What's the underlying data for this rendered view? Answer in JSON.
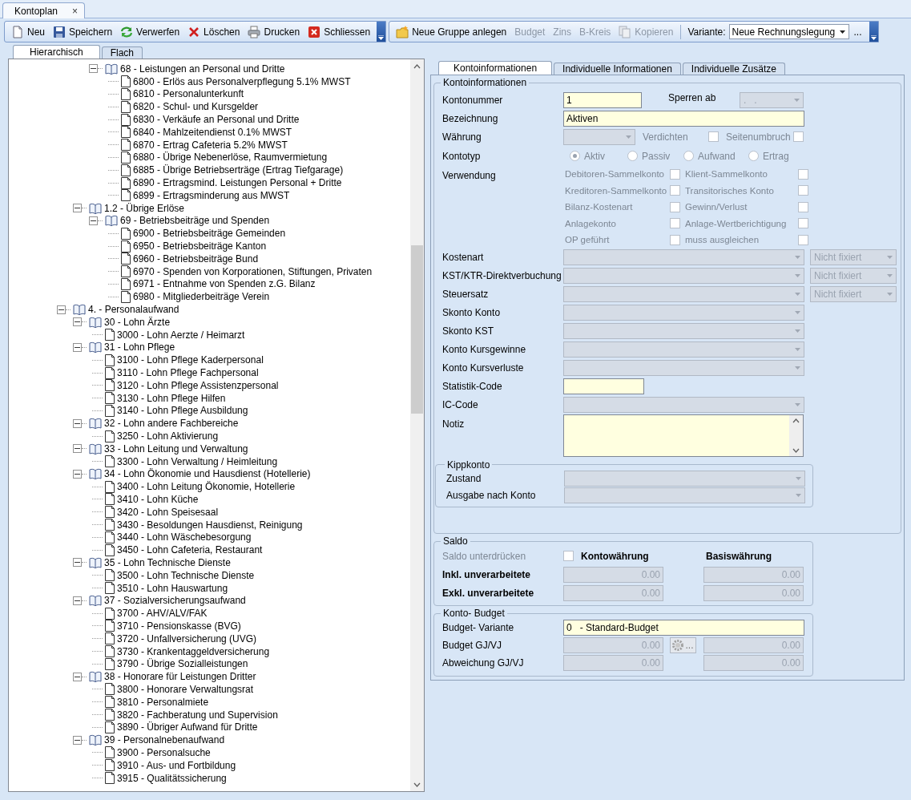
{
  "document_tabs": [
    {
      "label": "Kontoplan",
      "selected": true,
      "close": "×"
    }
  ],
  "toolbar": {
    "groups": [
      {
        "items": [
          {
            "kind": "new",
            "label": "Neu",
            "disabled": false
          },
          {
            "kind": "save",
            "label": "Speichern",
            "disabled": false
          },
          {
            "kind": "discard",
            "label": "Verwerfen",
            "disabled": false
          },
          {
            "kind": "delete",
            "label": "Löschen",
            "disabled": false
          },
          {
            "kind": "print",
            "label": "Drucken",
            "disabled": false
          },
          {
            "kind": "close",
            "label": "Schliessen",
            "disabled": false
          }
        ]
      },
      {
        "items": [
          {
            "kind": "new-group",
            "label": "Neue Gruppe anlegen",
            "disabled": false
          },
          {
            "kind": "text",
            "label": "Budget",
            "disabled": true
          },
          {
            "kind": "text",
            "label": "Zins",
            "disabled": true
          },
          {
            "kind": "text",
            "label": "B-Kreis",
            "disabled": true
          },
          {
            "kind": "copy",
            "label": "Kopieren",
            "disabled": true
          }
        ],
        "variant": {
          "label": "Variante:",
          "value": "Neue Rechnungslegung",
          "more": "..."
        }
      }
    ]
  },
  "view_tabs": [
    {
      "label": "Hierarchisch",
      "selected": true
    },
    {
      "label": "Flach",
      "selected": false
    }
  ],
  "tree": {
    "items": [
      {
        "children": [
          {
            "children": [
              {
                "children": [
                  {
                    "kind": "group",
                    "label": "68 - Leistungen an Personal und Dritte",
                    "expanded": true,
                    "children": [
                      {
                        "kind": "account",
                        "label": "6800 - Erlös aus Personalverpflegung 5.1% MWST"
                      },
                      {
                        "kind": "account",
                        "label": "6810 - Personalunterkunft"
                      },
                      {
                        "kind": "account",
                        "label": "6820 - Schul- und Kursgelder"
                      },
                      {
                        "kind": "account",
                        "label": "6830 - Verkäufe an Personal und Dritte"
                      },
                      {
                        "kind": "account",
                        "label": "6840 - Mahlzeitendienst 0.1% MWST"
                      },
                      {
                        "kind": "account",
                        "label": "6870 - Ertrag Cafeteria 5.2% MWST"
                      },
                      {
                        "kind": "account",
                        "label": "6880 - Übrige Nebenerlöse, Raumvermietung"
                      },
                      {
                        "kind": "account",
                        "label": "6885 - Übrige Betriebserträge (Ertrag Tiefgarage)"
                      },
                      {
                        "kind": "account",
                        "label": "6890 - Ertragsmind. Leistungen Personal + Dritte"
                      },
                      {
                        "kind": "account",
                        "label": "6899 - Ertragsminderung aus MWST"
                      }
                    ]
                  }
                ]
              },
              {
                "kind": "group",
                "label": "1.2 - Übrige Erlöse",
                "expanded": true,
                "children": [
                  {
                    "kind": "group",
                    "label": "69 - Betriebsbeiträge und Spenden",
                    "expanded": true,
                    "children": [
                      {
                        "kind": "account",
                        "label": "6900 - Betriebsbeiträge Gemeinden"
                      },
                      {
                        "kind": "account",
                        "label": "6950 - Betriebsbeiträge Kanton"
                      },
                      {
                        "kind": "account",
                        "label": "6960 - Betriebsbeiträge Bund"
                      },
                      {
                        "kind": "account",
                        "label": "6970 - Spenden von Korporationen, Stiftungen, Privaten"
                      },
                      {
                        "kind": "account",
                        "label": "6971 - Entnahme von Spenden z.G. Bilanz"
                      },
                      {
                        "kind": "account",
                        "label": "6980 - Mitgliederbeiträge Verein"
                      }
                    ]
                  }
                ]
              }
            ]
          },
          {
            "kind": "group",
            "label": "4. - Personalaufwand",
            "expanded": true,
            "children": [
              {
                "kind": "group",
                "label": "30 - Lohn Ärzte",
                "expanded": true,
                "children": [
                  {
                    "kind": "account",
                    "label": "3000 - Lohn Aerzte / Heimarzt"
                  }
                ]
              },
              {
                "kind": "group",
                "label": "31 - Lohn Pflege",
                "expanded": true,
                "children": [
                  {
                    "kind": "account",
                    "label": "3100 - Lohn Pflege Kaderpersonal"
                  },
                  {
                    "kind": "account",
                    "label": "3110 - Lohn Pflege Fachpersonal"
                  },
                  {
                    "kind": "account",
                    "label": "3120 - Lohn Pflege Assistenzpersonal"
                  },
                  {
                    "kind": "account",
                    "label": "3130 - Lohn Pflege Hilfen"
                  },
                  {
                    "kind": "account",
                    "label": "3140 - Lohn Pflege Ausbildung"
                  }
                ]
              },
              {
                "kind": "group",
                "label": "32 - Lohn andere Fachbereiche",
                "expanded": true,
                "children": [
                  {
                    "kind": "account",
                    "label": "3250 - Lohn Aktivierung"
                  }
                ]
              },
              {
                "kind": "group",
                "label": "33 - Lohn Leitung und Verwaltung",
                "expanded": true,
                "children": [
                  {
                    "kind": "account",
                    "label": "3300 - Lohn Verwaltung / Heimleitung"
                  }
                ]
              },
              {
                "kind": "group",
                "label": "34 - Lohn Ökonomie und Hausdienst (Hotellerie)",
                "expanded": true,
                "children": [
                  {
                    "kind": "account",
                    "label": "3400 - Lohn Leitung Ökonomie, Hotellerie"
                  },
                  {
                    "kind": "account",
                    "label": "3410 - Lohn Küche"
                  },
                  {
                    "kind": "account",
                    "label": "3420 - Lohn Speisesaal"
                  },
                  {
                    "kind": "account",
                    "label": "3430 - Besoldungen Hausdienst, Reinigung"
                  },
                  {
                    "kind": "account",
                    "label": "3440 - Lohn Wäschebesorgung"
                  },
                  {
                    "kind": "account",
                    "label": "3450 - Lohn Cafeteria, Restaurant"
                  }
                ]
              },
              {
                "kind": "group",
                "label": "35 - Lohn Technische Dienste",
                "expanded": true,
                "children": [
                  {
                    "kind": "account",
                    "label": "3500 - Lohn Technische Dienste"
                  },
                  {
                    "kind": "account",
                    "label": "3510 - Lohn Hauswartung"
                  }
                ]
              },
              {
                "kind": "group",
                "label": "37 - Sozialversicherungsaufwand",
                "expanded": true,
                "children": [
                  {
                    "kind": "account",
                    "label": "3700 - AHV/ALV/FAK"
                  },
                  {
                    "kind": "account",
                    "label": "3710 - Pensionskasse (BVG)"
                  },
                  {
                    "kind": "account",
                    "label": "3720 - Unfallversicherung (UVG)"
                  },
                  {
                    "kind": "account",
                    "label": "3730 - Krankentaggeldversicherung"
                  },
                  {
                    "kind": "account",
                    "label": "3790 - Übrige Sozialleistungen"
                  }
                ]
              },
              {
                "kind": "group",
                "label": "38 - Honorare für Leistungen Dritter",
                "expanded": true,
                "children": [
                  {
                    "kind": "account",
                    "label": "3800 - Honorare Verwaltungsrat"
                  },
                  {
                    "kind": "account",
                    "label": "3810 - Personalmiete"
                  },
                  {
                    "kind": "account",
                    "label": "3820 - Fachberatung und Supervision"
                  },
                  {
                    "kind": "account",
                    "label": "3890 - Übriger Aufwand für Dritte"
                  }
                ]
              },
              {
                "kind": "group",
                "label": "39 - Personalnebenaufwand",
                "expanded": true,
                "children": [
                  {
                    "kind": "account",
                    "label": "3900 - Personalsuche"
                  },
                  {
                    "kind": "account",
                    "label": "3910 - Aus- und Fortbildung"
                  },
                  {
                    "kind": "account",
                    "label": "3915 - Qualitätssicherung"
                  }
                ]
              }
            ]
          }
        ]
      }
    ]
  },
  "detail_tabs": [
    {
      "label": "Kontoinformationen",
      "selected": true
    },
    {
      "label": "Individuelle Informationen",
      "selected": false
    },
    {
      "label": "Individuelle Zusätze",
      "selected": false
    }
  ],
  "account_info": {
    "legend": "Kontoinformationen",
    "number": {
      "label": "Kontonummer",
      "value": "1"
    },
    "lock": {
      "label": "Sperren ab",
      "value": ".   .",
      "disabled": true
    },
    "name": {
      "label": "Bezeichnung",
      "value": "Aktiven"
    },
    "currency": {
      "label": "Währung",
      "disabled": true
    },
    "compress": {
      "label": "Verdichten",
      "checked": false,
      "disabled": true
    },
    "page_break": {
      "label": "Seitenumbruch",
      "checked": false,
      "disabled": true
    },
    "type": {
      "label": "Kontotyp",
      "disabled": true,
      "options": [
        {
          "label": "Aktiv",
          "selected": true
        },
        {
          "label": "Passiv",
          "selected": false
        },
        {
          "label": "Aufwand",
          "selected": false
        },
        {
          "label": "Ertrag",
          "selected": false
        }
      ]
    },
    "usage": {
      "label": "Verwendung",
      "disabled": true,
      "options": [
        {
          "label": "Debitoren-Sammelkonto",
          "checked": false
        },
        {
          "label": "Klient-Sammelkonto",
          "checked": false
        },
        {
          "label": "Kreditoren-Sammelkonto",
          "checked": false
        },
        {
          "label": "Transitorisches Konto",
          "checked": false
        },
        {
          "label": "Bilanz-Kostenart",
          "checked": false
        },
        {
          "label": "Gewinn/Verlust",
          "checked": false
        },
        {
          "label": "Anlagekonto",
          "checked": false
        },
        {
          "label": "Anlage-Wertberichtigung",
          "checked": false
        },
        {
          "label": "OP geführt",
          "checked": false
        },
        {
          "label": "muss ausgleichen",
          "checked": false
        }
      ]
    },
    "lookups": [
      {
        "label": "Kostenart",
        "disabled": true,
        "fix": "Nicht fixiert"
      },
      {
        "label": "KST/KTR-Direktverbuchung",
        "disabled": true,
        "fix": "Nicht fixiert"
      },
      {
        "label": "Steuersatz",
        "disabled": true,
        "fix": "Nicht fixiert"
      },
      {
        "label": "Skonto Konto",
        "disabled": true
      },
      {
        "label": "Skonto KST",
        "disabled": true
      },
      {
        "label": "Konto Kursgewinne",
        "disabled": true
      },
      {
        "label": "Konto Kursverluste",
        "disabled": true
      }
    ],
    "statistic_code": {
      "label": "Statistik-Code"
    },
    "ic_code": {
      "label": "IC-Code",
      "disabled": true
    },
    "note": {
      "label": "Notiz"
    },
    "flip_account": {
      "legend": "Kippkonto",
      "rows": [
        {
          "label": "Zustand",
          "disabled": true
        },
        {
          "label": "Ausgabe nach Konto",
          "disabled": true
        }
      ]
    }
  },
  "saldo": {
    "legend": "Saldo",
    "suppress": {
      "label": "Saldo unterdrücken",
      "checked": false,
      "disabled": true
    },
    "columns": [
      "Kontowährung",
      "Basiswährung"
    ],
    "rows": [
      {
        "label": "Inkl. unverarbeitete",
        "values": [
          "0.00",
          "0.00"
        ],
        "disabled": true
      },
      {
        "label": "Exkl. unverarbeitete",
        "values": [
          "0.00",
          "0.00"
        ],
        "disabled": true
      }
    ]
  },
  "budget": {
    "legend": "Konto- Budget",
    "variant": {
      "label": "Budget- Variante",
      "value": "0   - Standard-Budget"
    },
    "rows": [
      {
        "label": "Budget GJ/VJ",
        "values": [
          "0.00",
          "0.00"
        ],
        "disabled": true,
        "button": "..."
      },
      {
        "label": "Abweichung GJ/VJ",
        "values": [
          "0.00",
          "0.00"
        ],
        "disabled": true
      }
    ]
  }
}
